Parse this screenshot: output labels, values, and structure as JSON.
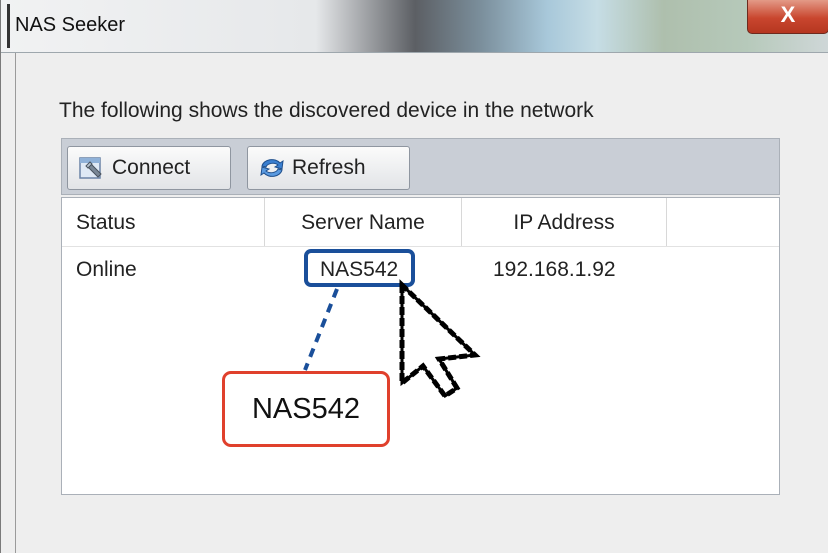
{
  "window": {
    "title": "NAS Seeker",
    "close_label": "X"
  },
  "main": {
    "info_text": "The following shows the discovered device in the network"
  },
  "toolbar": {
    "connect_label": "Connect",
    "connect_icon": "connect-icon",
    "refresh_label": "Refresh",
    "refresh_icon": "refresh-icon"
  },
  "table": {
    "columns": [
      "Status",
      "Server Name",
      "IP Address"
    ],
    "rows": [
      {
        "status": "Online",
        "server_name": "NAS542",
        "ip_address": "192.168.1.92"
      }
    ]
  },
  "annotation": {
    "callout_text": "NAS542",
    "highlight_color": "#1a4f9a",
    "callout_border_color": "#e0402c"
  },
  "cursor": {
    "icon": "pointer-cursor-icon"
  }
}
